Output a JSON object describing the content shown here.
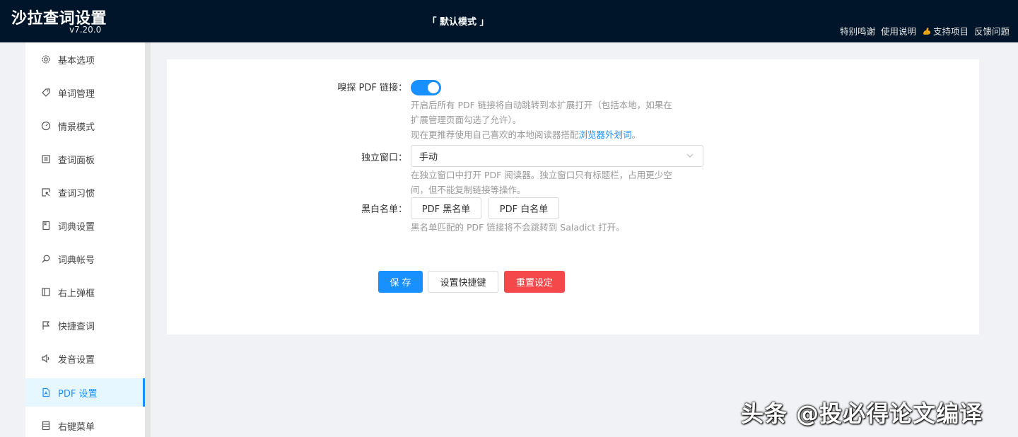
{
  "header": {
    "app_title": "沙拉查词设置",
    "version": "v7.20.0",
    "mode": "「 默认模式 」",
    "links": [
      "特别鸣谢",
      "使用说明",
      "支持项目",
      "反馈问题"
    ]
  },
  "sidebar": {
    "items": [
      {
        "label": "基本选项",
        "icon": "gear-icon"
      },
      {
        "label": "单词管理",
        "icon": "tag-icon"
      },
      {
        "label": "情景模式",
        "icon": "dashboard-icon"
      },
      {
        "label": "查词面板",
        "icon": "panel-icon"
      },
      {
        "label": "查词习惯",
        "icon": "select-icon"
      },
      {
        "label": "词典设置",
        "icon": "book-icon"
      },
      {
        "label": "词典帐号",
        "icon": "search-icon"
      },
      {
        "label": "右上弹框",
        "icon": "layout-icon"
      },
      {
        "label": "快捷查词",
        "icon": "flag-icon"
      },
      {
        "label": "发音设置",
        "icon": "sound-icon"
      },
      {
        "label": "PDF 设置",
        "icon": "pdf-file-icon",
        "active": true
      },
      {
        "label": "右键菜单",
        "icon": "menu-icon"
      }
    ]
  },
  "form": {
    "sniff_label": "嗅探 PDF 链接：",
    "sniff_enabled": true,
    "sniff_help_line1": "开启后所有 PDF 链接将自动跳转到本扩展打开（包括本地，如果在",
    "sniff_help_line2": "扩展管理页面勾选了允许）。",
    "sniff_help_line3": "现在更推荐使用自己喜欢的本地阅读器搭配",
    "sniff_help_link": "浏览器外划词",
    "sniff_help_end": "。",
    "window_label": "独立窗口：",
    "window_value": "手动",
    "window_help_line1": "在独立窗口中打开 PDF 阅读器。独立窗口只有标题栏，占用更少空",
    "window_help_line2": "间，但不能复制链接等操作。",
    "list_label": "黑白名单：",
    "blacklist_button": "PDF 黑名单",
    "whitelist_button": "PDF 白名单",
    "list_help": "黑名单匹配的 PDF 链接将不会跳转到 Saladict 打开。"
  },
  "actions": {
    "save": "保 存",
    "shortcut": "设置快捷键",
    "reset": "重置设定"
  },
  "watermark": "头条 @投必得论文编译",
  "colors": {
    "header_bg": "#001529",
    "primary": "#1890ff",
    "danger": "#f5484a"
  }
}
